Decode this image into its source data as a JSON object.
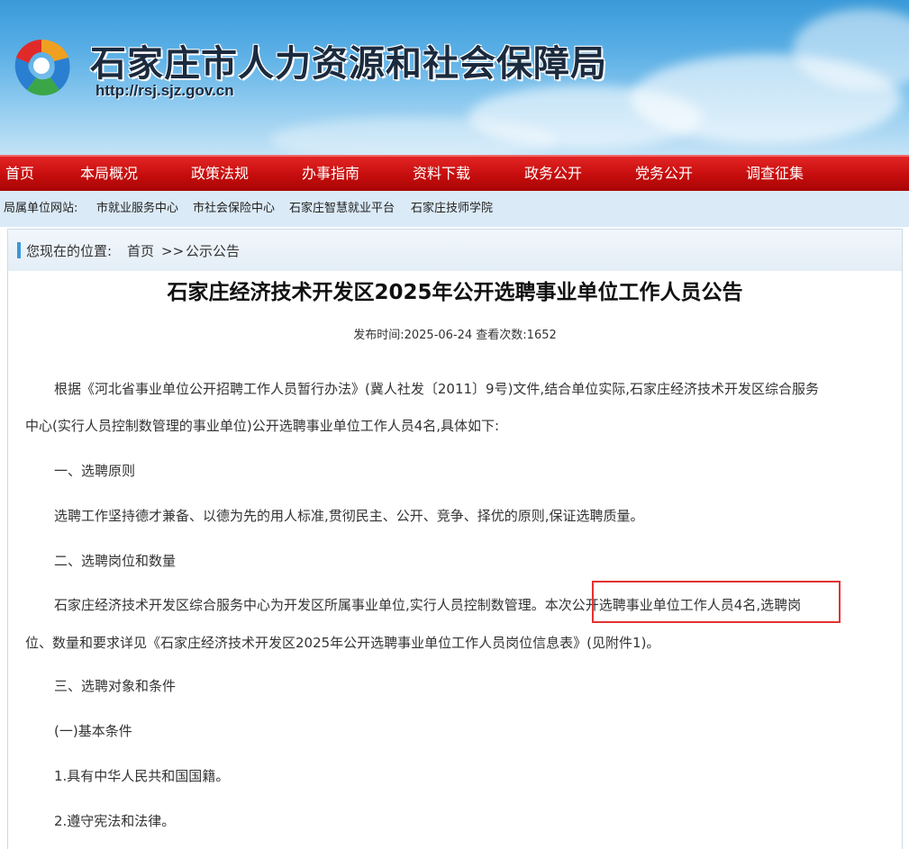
{
  "header": {
    "title": "石家庄市人力资源和社会保障局",
    "url": "http://rsj.sjz.gov.cn",
    "logo_icon": "logo-icon"
  },
  "nav": {
    "items": [
      "首页",
      "本局概况",
      "政策法规",
      "办事指南",
      "资料下载",
      "政务公开",
      "党务公开",
      "调查征集"
    ]
  },
  "sublinks": {
    "label": "局属单位网站:",
    "links": [
      "市就业服务中心",
      "市社会保险中心",
      "石家庄智慧就业平台",
      "石家庄技师学院"
    ]
  },
  "breadcrumb": {
    "prefix": "您现在的位置:",
    "home": "首页",
    "separator": ">>",
    "current": "公示公告"
  },
  "article": {
    "title": "石家庄经济技术开发区2025年公开选聘事业单位工作人员公告",
    "meta": "发布时间:2025-06-24 查看次数:1652",
    "intro_line1": "根据《河北省事业单位公开招聘工作人员暂行办法》(冀人社发〔2011〕9号)文件,结合单位实际,石家庄经济技术开发区综合服务",
    "intro_line2": "中心(实行人员控制数管理的事业单位)公开选聘事业单位工作人员4名,具体如下:",
    "section1_heading": "一、选聘原则",
    "section1_text": "选聘工作坚持德才兼备、以德为先的用人标准,贯彻民主、公开、竞争、择优的原则,保证选聘质量。",
    "section2_heading": "二、选聘岗位和数量",
    "section2_line1": "石家庄经济技术开发区综合服务中心为开发区所属事业单位,实行人员控制数管理。本次公开选聘事业单位工作人员4名,选聘岗",
    "section2_line2": "位、数量和要求详见《石家庄经济技术开发区2025年公开选聘事业单位工作人员岗位信息表》(见附件1)。",
    "section3_heading": "三、选聘对象和条件",
    "basic_conditions_heading": "(一)基本条件",
    "condition1": "1.具有中华人民共和国国籍。",
    "condition2": "2.遵守宪法和法律。"
  },
  "colors": {
    "nav_red": "#c60d0d",
    "highlight_box": "#e33232",
    "crumb_accent": "#3a98d8",
    "sublink_bar": "#dbeaf7"
  }
}
